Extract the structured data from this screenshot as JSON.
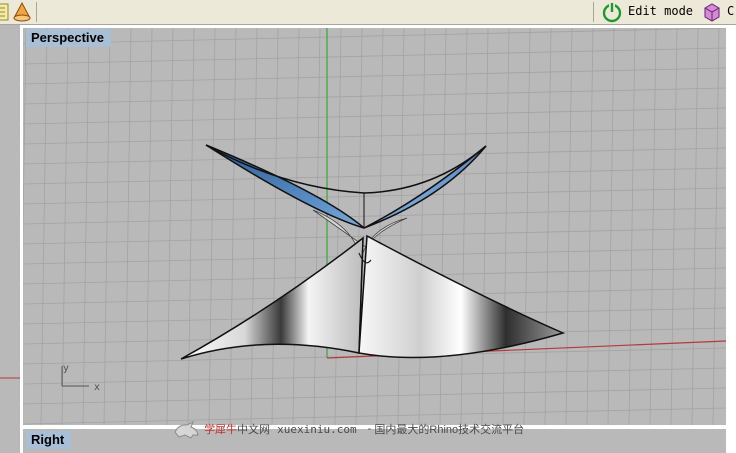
{
  "toolbar": {
    "edit_mode_label": "Edit mode",
    "truncated_label": "C",
    "icons": [
      "grid-snap-icon",
      "cone-icon",
      "power-icon",
      "box-icon"
    ]
  },
  "perspective": {
    "title": "Perspective"
  },
  "right_view": {
    "title": "Right"
  },
  "axis": {
    "y_label": "y",
    "x_label": "x"
  },
  "watermark": {
    "brand": "学犀牛",
    "sub": "中文网",
    "url": "xuexiniu.com",
    "dash": "-",
    "slogan": "国内最大的Rhino技术交流平台"
  },
  "colors": {
    "viewport_bg": "#b9b9b9",
    "grid_line": "#a3a3a3",
    "grid_green": "#3aa53a",
    "grid_red": "#b33a3a",
    "title_bg": "#a9bfd6",
    "frame": "#ffffff",
    "toolbar_bg": "#ece9d8",
    "surface_blue": "#4e7fb6"
  }
}
